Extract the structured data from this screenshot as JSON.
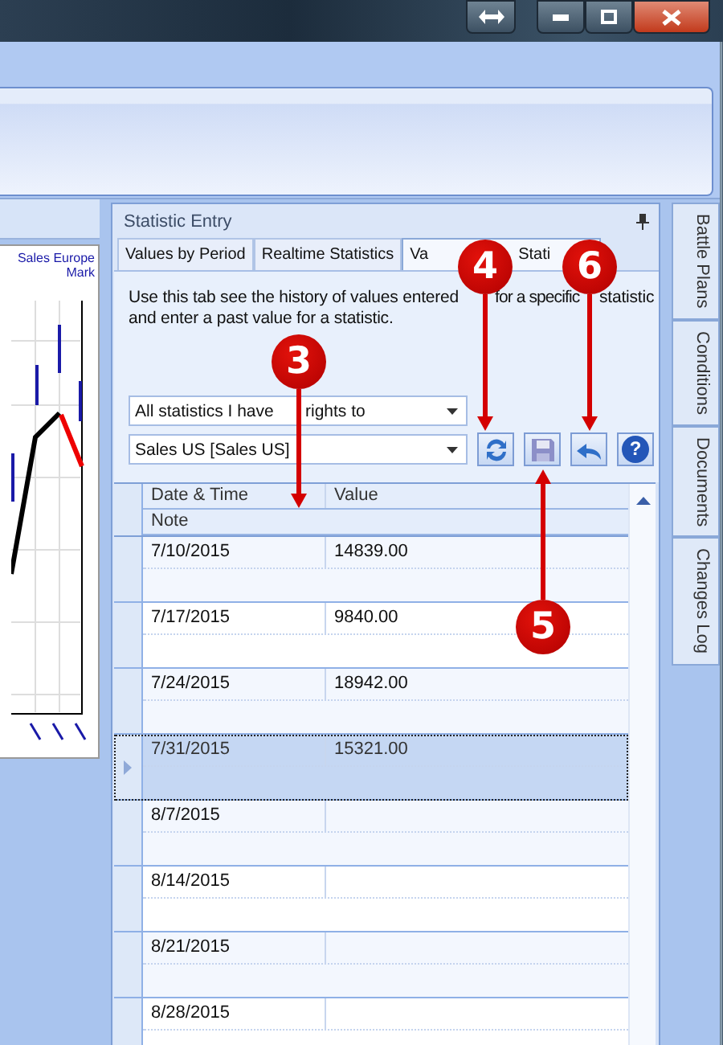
{
  "chart_panel": {
    "legend": [
      "Sales Europe",
      "Mark"
    ]
  },
  "panel": {
    "title": "Statistic Entry",
    "tabs": [
      {
        "label": "Values by Period",
        "selected": false
      },
      {
        "label": "Realtime Statistics",
        "selected": false
      },
      {
        "label_parts": [
          "Va",
          "Stati"
        ],
        "selected": true
      }
    ],
    "description_lines": [
      [
        "Use this tab see the history of values entered",
        "for a specific",
        "statistic"
      ],
      [
        "and enter a past value for a statistic."
      ]
    ],
    "filter": {
      "value_parts": [
        "All statistics I have",
        "rights to"
      ]
    },
    "statistic": {
      "value": "Sales US [Sales US]"
    },
    "help_glyph": "?",
    "grid": {
      "columns": [
        "Date & Time",
        "Value"
      ],
      "note_column": "Note",
      "rows": [
        {
          "date": "7/10/2015",
          "value": "14839.00",
          "selected": false
        },
        {
          "date": "7/17/2015",
          "value": "9840.00",
          "selected": false
        },
        {
          "date": "7/24/2015",
          "value": "18942.00",
          "selected": false
        },
        {
          "date": "7/31/2015",
          "value": "15321.00",
          "selected": true
        },
        {
          "date": "8/7/2015",
          "selected": false
        },
        {
          "date": "8/14/2015",
          "selected": false
        },
        {
          "date": "8/21/2015",
          "selected": false
        },
        {
          "date": "8/28/2015",
          "selected": false
        }
      ]
    }
  },
  "side_tabs": [
    "Battle Plans",
    "Conditions",
    "Documents",
    "Changes Log"
  ],
  "callouts": [
    "3",
    "4",
    "6",
    "5"
  ]
}
